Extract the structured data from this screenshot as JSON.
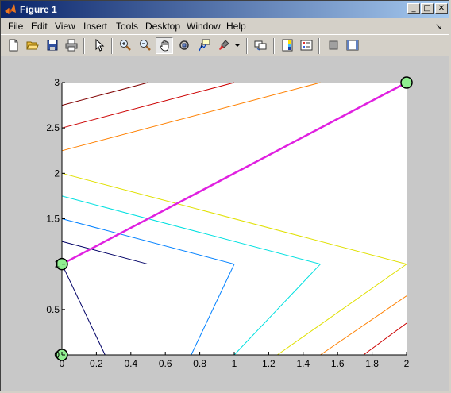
{
  "window": {
    "title": "Figure 1",
    "buttons": {
      "minimize": "_",
      "maximize": "□",
      "close": "✕"
    }
  },
  "menubar": {
    "items": [
      {
        "label": "File"
      },
      {
        "label": "Edit"
      },
      {
        "label": "View"
      },
      {
        "label": "Insert"
      },
      {
        "label": "Tools"
      },
      {
        "label": "Desktop"
      },
      {
        "label": "Window"
      },
      {
        "label": "Help"
      }
    ],
    "dock_arrow": "↘"
  },
  "toolbar": {
    "tools": [
      "new-figure",
      "open-file",
      "save-figure",
      "print-figure",
      "edit-plot",
      "zoom-in",
      "zoom-out",
      "pan",
      "rotate-3d",
      "data-cursor",
      "brush",
      "brush-dropdown",
      "link-plot",
      "insert-colorbar",
      "insert-legend",
      "hide-plot-tools",
      "show-plot-tools"
    ],
    "pressed": "pan"
  },
  "chart_data": {
    "type": "line",
    "title": "",
    "xlabel": "",
    "ylabel": "",
    "xlim": [
      0,
      2
    ],
    "ylim": [
      0,
      3
    ],
    "xticks": [
      "0",
      "0.2",
      "0.4",
      "0.6",
      "0.8",
      "1",
      "1.2",
      "1.4",
      "1.6",
      "1.8",
      "2"
    ],
    "yticks": [
      {
        "value": 0,
        "label": "0"
      },
      {
        "value": 0.5,
        "label": "0.5"
      },
      {
        "value": 1,
        "label": "1"
      },
      {
        "value": 1.5,
        "label": "1.5"
      },
      {
        "value": 2,
        "label": "2"
      },
      {
        "value": 2.5,
        "label": "2.5"
      },
      {
        "value": 3,
        "label": "3"
      }
    ],
    "grid": false,
    "series": [
      {
        "color": "#000066",
        "width": 1,
        "points": [
          [
            0,
            1.25
          ],
          [
            0.5,
            1
          ],
          [
            0.5,
            0
          ]
        ]
      },
      {
        "color": "#000066",
        "width": 1,
        "points": [
          [
            0,
            1
          ],
          [
            0.25,
            0
          ]
        ]
      },
      {
        "color": "#0080ff",
        "width": 1,
        "points": [
          [
            0,
            1.5
          ],
          [
            1,
            1
          ],
          [
            0.75,
            0
          ]
        ]
      },
      {
        "color": "#00e0e0",
        "width": 1,
        "points": [
          [
            0,
            1.75
          ],
          [
            1.5,
            1
          ],
          [
            1,
            0
          ]
        ]
      },
      {
        "color": "#e0e000",
        "width": 1,
        "points": [
          [
            0,
            2
          ],
          [
            2,
            1
          ],
          [
            1.25,
            0
          ]
        ]
      },
      {
        "color": "#ff8000",
        "width": 1,
        "points": [
          [
            2,
            0.65
          ],
          [
            1.5,
            0
          ]
        ]
      },
      {
        "color": "#ff8000",
        "width": 1,
        "points": [
          [
            0,
            2.25
          ],
          [
            1.5,
            3
          ]
        ]
      },
      {
        "color": "#cc0000",
        "width": 1,
        "points": [
          [
            2,
            0.35
          ],
          [
            1.75,
            0
          ]
        ]
      },
      {
        "color": "#cc0000",
        "width": 1,
        "points": [
          [
            0,
            2.5
          ],
          [
            1,
            3
          ]
        ]
      },
      {
        "color": "#800000",
        "width": 1,
        "points": [
          [
            0,
            2.75
          ],
          [
            0.5,
            3
          ]
        ]
      },
      {
        "color": "#e020e0",
        "width": 2.5,
        "points": [
          [
            0,
            1
          ],
          [
            2,
            3
          ]
        ]
      },
      {
        "color": "#e020e0",
        "width": 1,
        "points": [
          [
            0,
            0
          ],
          [
            0,
            1
          ]
        ]
      }
    ],
    "markers": [
      {
        "x": 0,
        "y": 0,
        "color": "#90ee90"
      },
      {
        "x": 0,
        "y": 1,
        "color": "#90ee90"
      },
      {
        "x": 2,
        "y": 3,
        "color": "#90ee90"
      }
    ]
  }
}
